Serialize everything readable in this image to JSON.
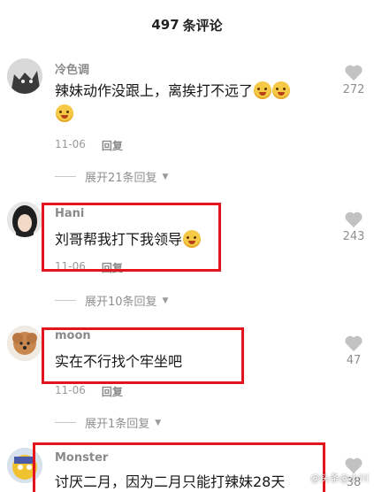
{
  "header": {
    "count": "497",
    "label": "条评论"
  },
  "comments": [
    {
      "username": "冷色调",
      "text_line1": "辣妹动作没跟上，离挨打不远了",
      "date": "11-06",
      "reply_label": "回复",
      "expand_label": "展开21条回复",
      "likes": "272",
      "avatar_icon": "cat-avatar-icon"
    },
    {
      "username": "Hani",
      "text_line1": "刘哥帮我打下我领导",
      "date": "11-06",
      "reply_label": "回复",
      "expand_label": "展开10条回复",
      "likes": "243",
      "avatar_icon": "girl-avatar-icon"
    },
    {
      "username": "moon",
      "text_line1": "实在不行找个牢坐吧",
      "date": "11-06",
      "reply_label": "回复",
      "expand_label": "展开1条回复",
      "likes": "47",
      "avatar_icon": "poodle-avatar-icon"
    },
    {
      "username": "Monster",
      "text_line1": "讨厌二月，因为二月只能打辣妹28天",
      "likes": "38",
      "avatar_icon": "cartoon-avatar-icon"
    }
  ],
  "watermark": "@头条@小川",
  "colors": {
    "highlight_box": "#e3141b",
    "emoji": "#f5c846"
  }
}
